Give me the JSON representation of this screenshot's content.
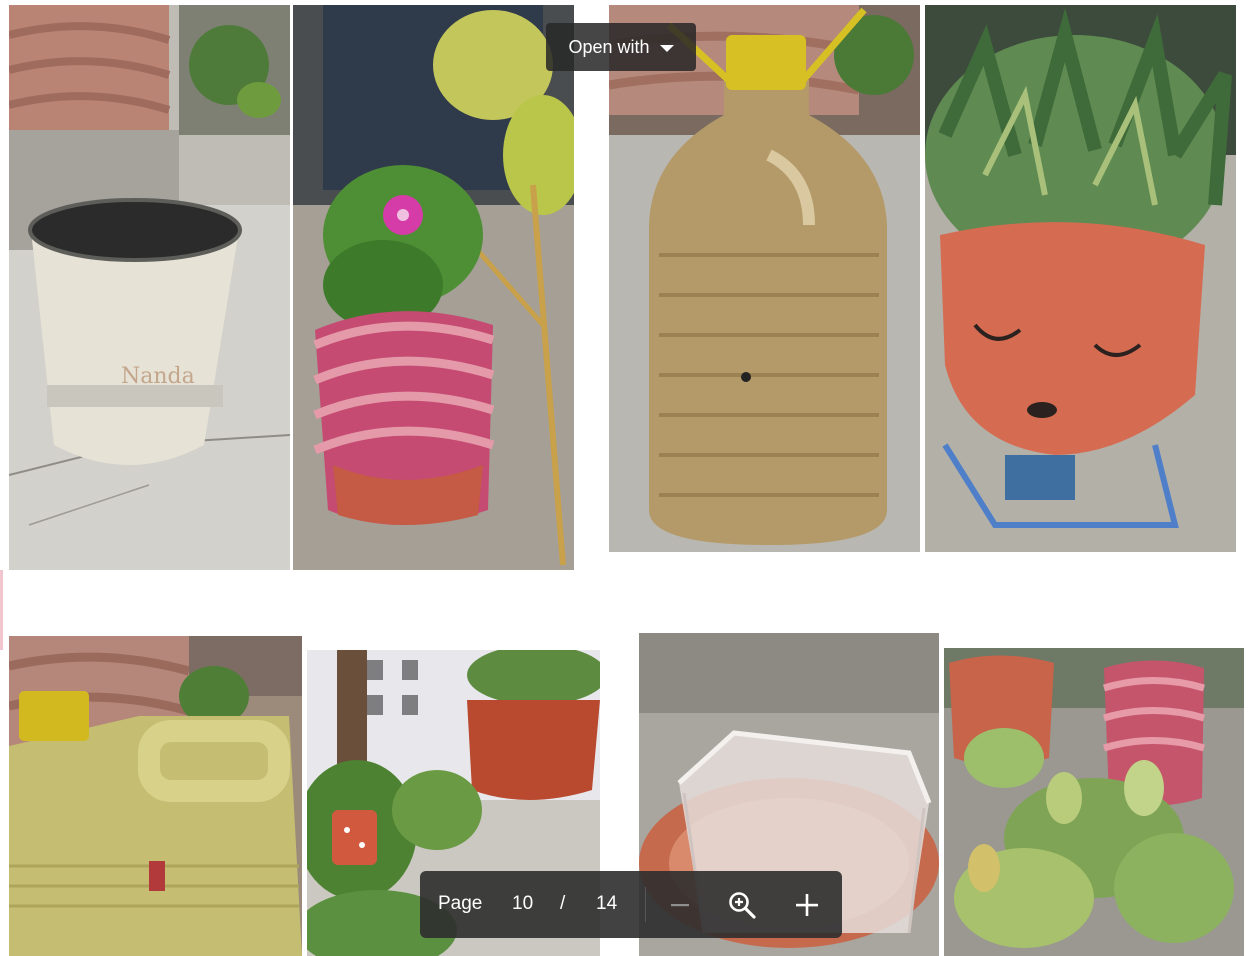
{
  "toolbar": {
    "open_with_label": "Open with",
    "open_with_icon": "chevron-down-icon"
  },
  "page_control": {
    "label": "Page",
    "current": "10",
    "separator": "/",
    "total": "14",
    "zoom_out_icon": "minus-icon",
    "zoom_icon": "zoom-in-icon",
    "zoom_in_icon": "plus-icon"
  },
  "colors": {
    "overlay_bg": "#2d2d2d",
    "page_bg": "#ffffff",
    "edge_accent": "#f2c6cf"
  }
}
